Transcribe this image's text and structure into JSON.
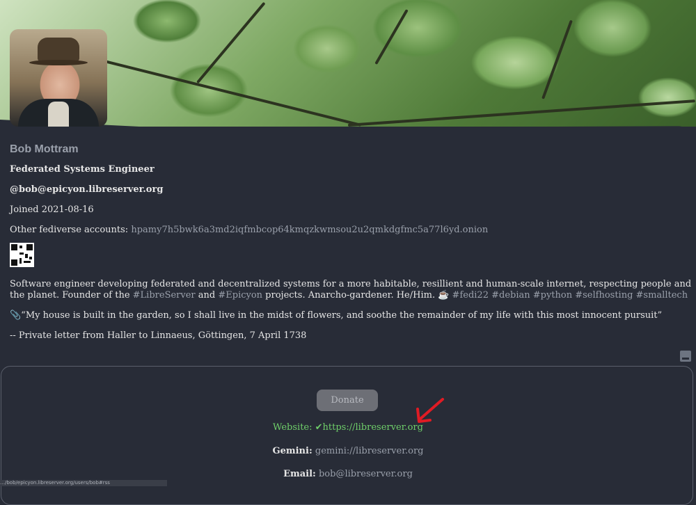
{
  "profile": {
    "name": "Bob Mottram",
    "role": "Federated Systems Engineer",
    "handle": "@bob@epicyon.libreserver.org",
    "joined": "Joined 2021-08-16",
    "other_accounts_label": "Other fediverse accounts:",
    "other_accounts_value": "hpamy7h5bwk6a3md2iqfmbcop64kmqzkwmsou2u2qmkdgfmc5a77l6yd.onion"
  },
  "bio": {
    "text_1": "Software engineer developing federated and decentralized systems for a more habitable, resillient and human-scale internet, respecting people and the planet. Founder of the ",
    "tag_libreserver": "#LibreServer",
    "and": " and ",
    "tag_epicyon": "#Epicyon",
    "text_2": " projects. Anarcho-gardener. He/Him. ",
    "emoji": "☕",
    "tags_rest": " #fedi22 #debian #python #selfhosting #smalltech",
    "quote": "📎“My house is built in the garden, so I shall live in the midst of flowers, and soothe the remainder of my life with this most innocent pursuit”",
    "attribution": "-- Private letter from Haller to Linnaeus, Göttingen, 7 April 1738"
  },
  "contact": {
    "donate_label": "Donate",
    "website_label": "Website:",
    "website_value": "✔https://libreserver.org",
    "gemini_label": "Gemini:",
    "gemini_value": "gemini://libreserver.org",
    "email_label": "Email:",
    "email_value": "bob@libreserver.org"
  },
  "status_bar": "…/bob/epicyon.libreserver.org/users/bob#rss",
  "colors": {
    "background": "#282c37",
    "accent_green": "#6fcf6a",
    "muted": "#9aa0ab",
    "arrow": "#e01b24"
  },
  "icons": [
    "qr-code-icon",
    "rss-feed-icon",
    "annotation-arrow-icon"
  ]
}
